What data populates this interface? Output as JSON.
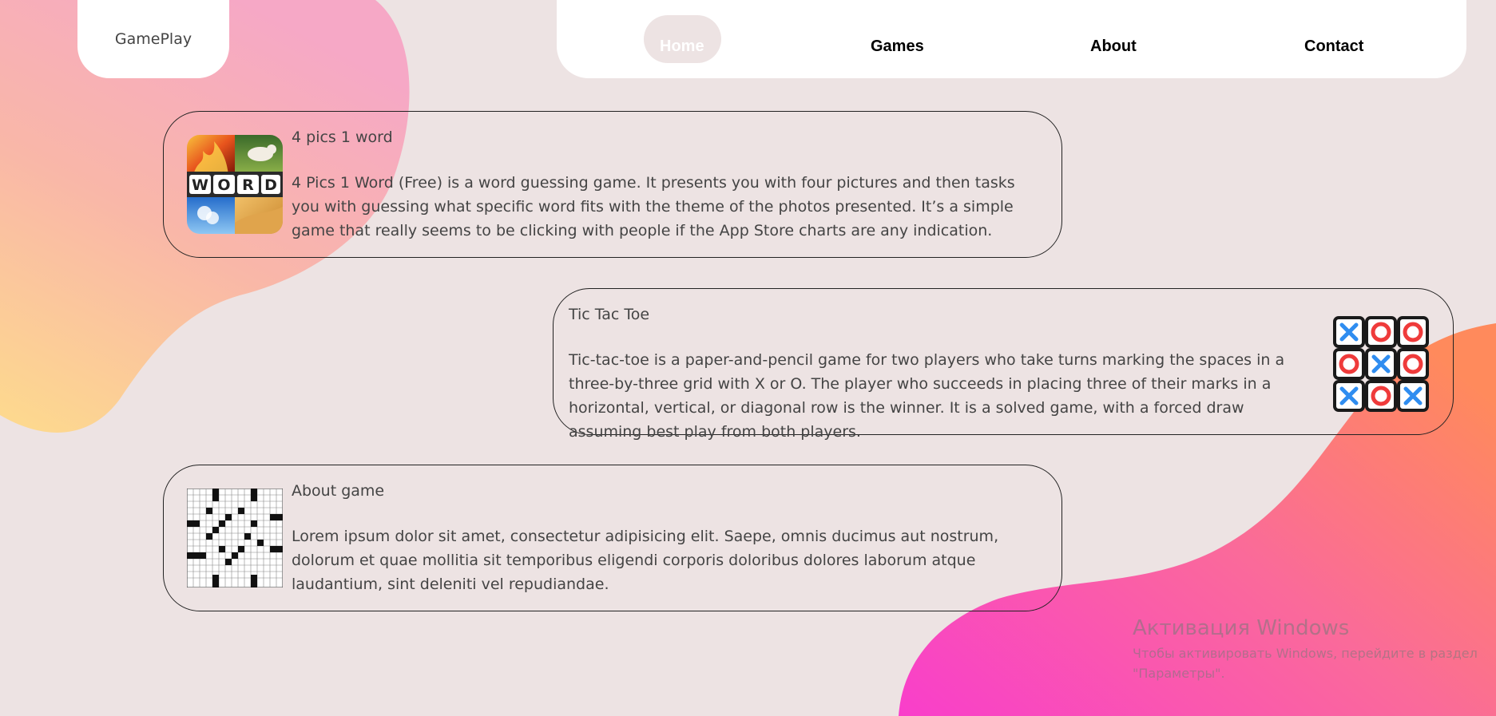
{
  "header": {
    "logo": "GamePlay",
    "nav": {
      "home": "Home",
      "games": "Games",
      "about": "About",
      "contact": "Contact"
    }
  },
  "cards": [
    {
      "title": "4 pics 1 word",
      "description": "4 Pics 1 Word (Free) is a word guessing game. It presents you with four pictures and then tasks you with guessing what specific word fits with the theme of the photos presented. It’s a simple game that really seems to be clicking with people if the App Store charts are any indication.",
      "thumb_text": "WORD"
    },
    {
      "title": "Tic Tac Toe",
      "description": "Tic-tac-toe is a paper-and-pencil game for two players who take turns marking the spaces in a three-by-three grid with X or O. The player who succeeds in placing three of their marks in a horizontal, vertical, or diagonal row is the winner. It is a solved game, with a forced draw assuming best play from both players."
    },
    {
      "title": "About game",
      "description": "Lorem ipsum dolor sit amet, consectetur adipisicing elit. Saepe, omnis ducimus aut nostrum, dolorum et quae mollitia sit temporibus eligendi corporis doloribus dolores laborum atque laudantium, sint deleniti vel repudiandae."
    }
  ],
  "watermark": {
    "title": "Активация Windows",
    "subtitle": "Чтобы активировать Windows, перейдите в раздел \"Параметры\"."
  },
  "colors": {
    "background": "#ede3e3",
    "blob_pink": "#f7a9c4",
    "blob_yellow": "#fdd58e",
    "blob_magenta": "#f93ecb",
    "blob_orange": "#ff8a5c",
    "x_mark": "#2f8df0",
    "o_mark": "#ef3b3b"
  }
}
